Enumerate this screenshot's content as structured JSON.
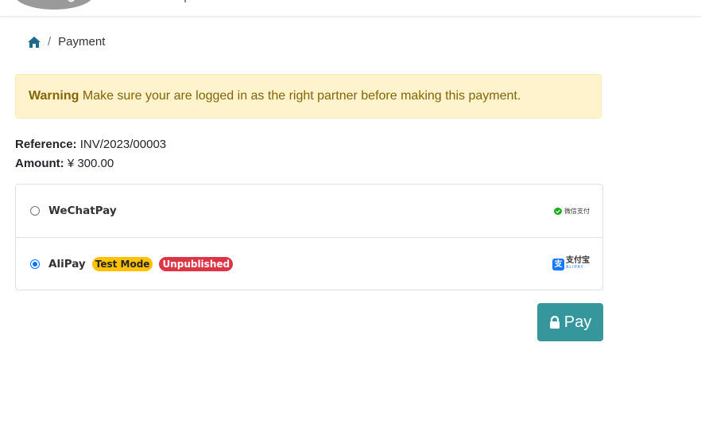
{
  "breadcrumb": {
    "home_icon": "home-icon",
    "separator": "/",
    "current": "Payment"
  },
  "alert": {
    "title": "Warning",
    "message": "Make sure your are logged in as the right partner before making this payment."
  },
  "details": {
    "reference_label": "Reference:",
    "reference_value": "INV/2023/00003",
    "amount_label": "Amount:",
    "amount_value": "¥ 300.00"
  },
  "payment_methods": [
    {
      "name": "WeChatPay",
      "selected": false,
      "logo_text": "微信支付",
      "logo_icon": "wechat-icon"
    },
    {
      "name": "AliPay",
      "selected": true,
      "badges": [
        "Test Mode",
        "Unpublished"
      ],
      "logo_text": "支付宝",
      "logo_subtext": "ALIPAY",
      "logo_icon": "alipay-icon",
      "logo_icon_char": "支"
    }
  ],
  "pay_button": {
    "label": "Pay",
    "icon": "lock-icon"
  },
  "colors": {
    "warning_bg": "#fff3cd",
    "warning_text": "#856404",
    "pay_button": "#35979c",
    "badge_test": "#ffc107",
    "badge_unpublished": "#dc3545",
    "breadcrumb_home": "#1e6a8d"
  }
}
